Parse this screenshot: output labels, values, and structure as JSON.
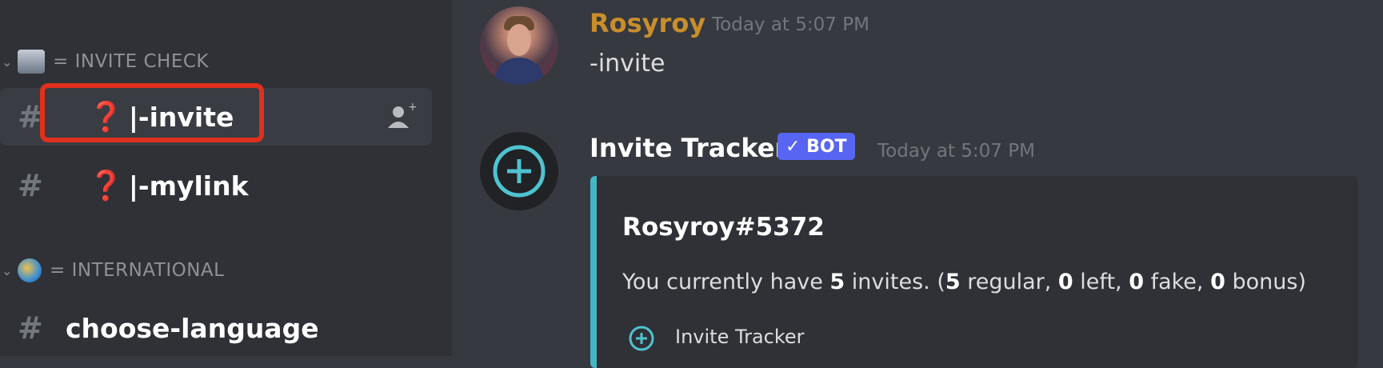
{
  "sidebar": {
    "categories": [
      {
        "label": "= INVITE CHECK"
      },
      {
        "label": "= INTERNATIONAL"
      }
    ],
    "channels": [
      {
        "prefix": "❓",
        "label": "|-invite",
        "active": true
      },
      {
        "prefix": "❓",
        "label": "|-mylink",
        "active": false
      },
      {
        "prefix": "",
        "label": "choose-language",
        "active": false
      }
    ]
  },
  "messages": [
    {
      "author": "Rosyroy",
      "author_color": "#c98e2b",
      "timestamp": "Today at 5:07 PM",
      "content": "-invite"
    },
    {
      "author": "Invite Tracker",
      "author_color": "#ffffff",
      "bot_tag": "✓ BOT",
      "timestamp": "Today at 5:07 PM",
      "embed": {
        "accent": "#43b6c4",
        "title": "Rosyroy#5372",
        "desc_prefix": "You currently have ",
        "total": "5",
        "desc_mid1": " invites. (",
        "regular": "5",
        "desc_mid2": " regular, ",
        "left": "0",
        "desc_mid3": " left, ",
        "fake": "0",
        "desc_mid4": " fake, ",
        "bonus": "0",
        "desc_suffix": " bonus)",
        "footer": "Invite Tracker"
      }
    }
  ],
  "colors": {
    "highlight": "#e0301e",
    "bot_tag": "#5865f2"
  }
}
